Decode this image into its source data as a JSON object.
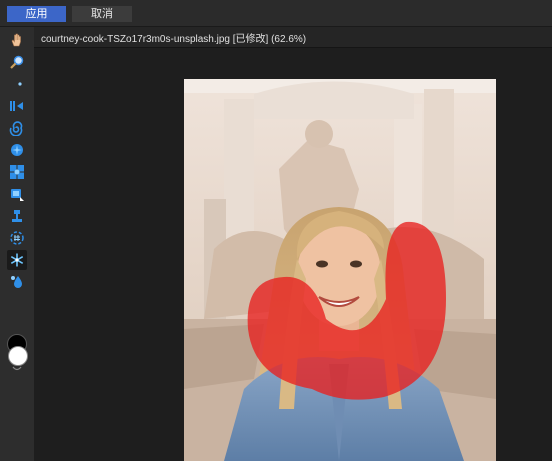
{
  "actions": {
    "apply_label": "应用",
    "cancel_label": "取消"
  },
  "document": {
    "title": "courtney-cook-TSZo17r3m0s-unsplash.jpg [已修改] (62.6%)"
  },
  "tools": [
    {
      "name": "hand-icon"
    },
    {
      "name": "zoom-icon"
    },
    {
      "name": "forward-warp-icon"
    },
    {
      "name": "reconstruct-icon"
    },
    {
      "name": "twirl-icon"
    },
    {
      "name": "pucker-icon"
    },
    {
      "name": "bloat-icon"
    },
    {
      "name": "push-left-icon"
    },
    {
      "name": "mirror-icon"
    },
    {
      "name": "turbulence-icon"
    },
    {
      "name": "freeze-mask-icon",
      "active": true
    },
    {
      "name": "thaw-mask-icon"
    }
  ],
  "colors": {
    "accent": "#3c66c8",
    "mask": "#e8201f",
    "foreground": "#000000",
    "background": "#ffffff"
  }
}
